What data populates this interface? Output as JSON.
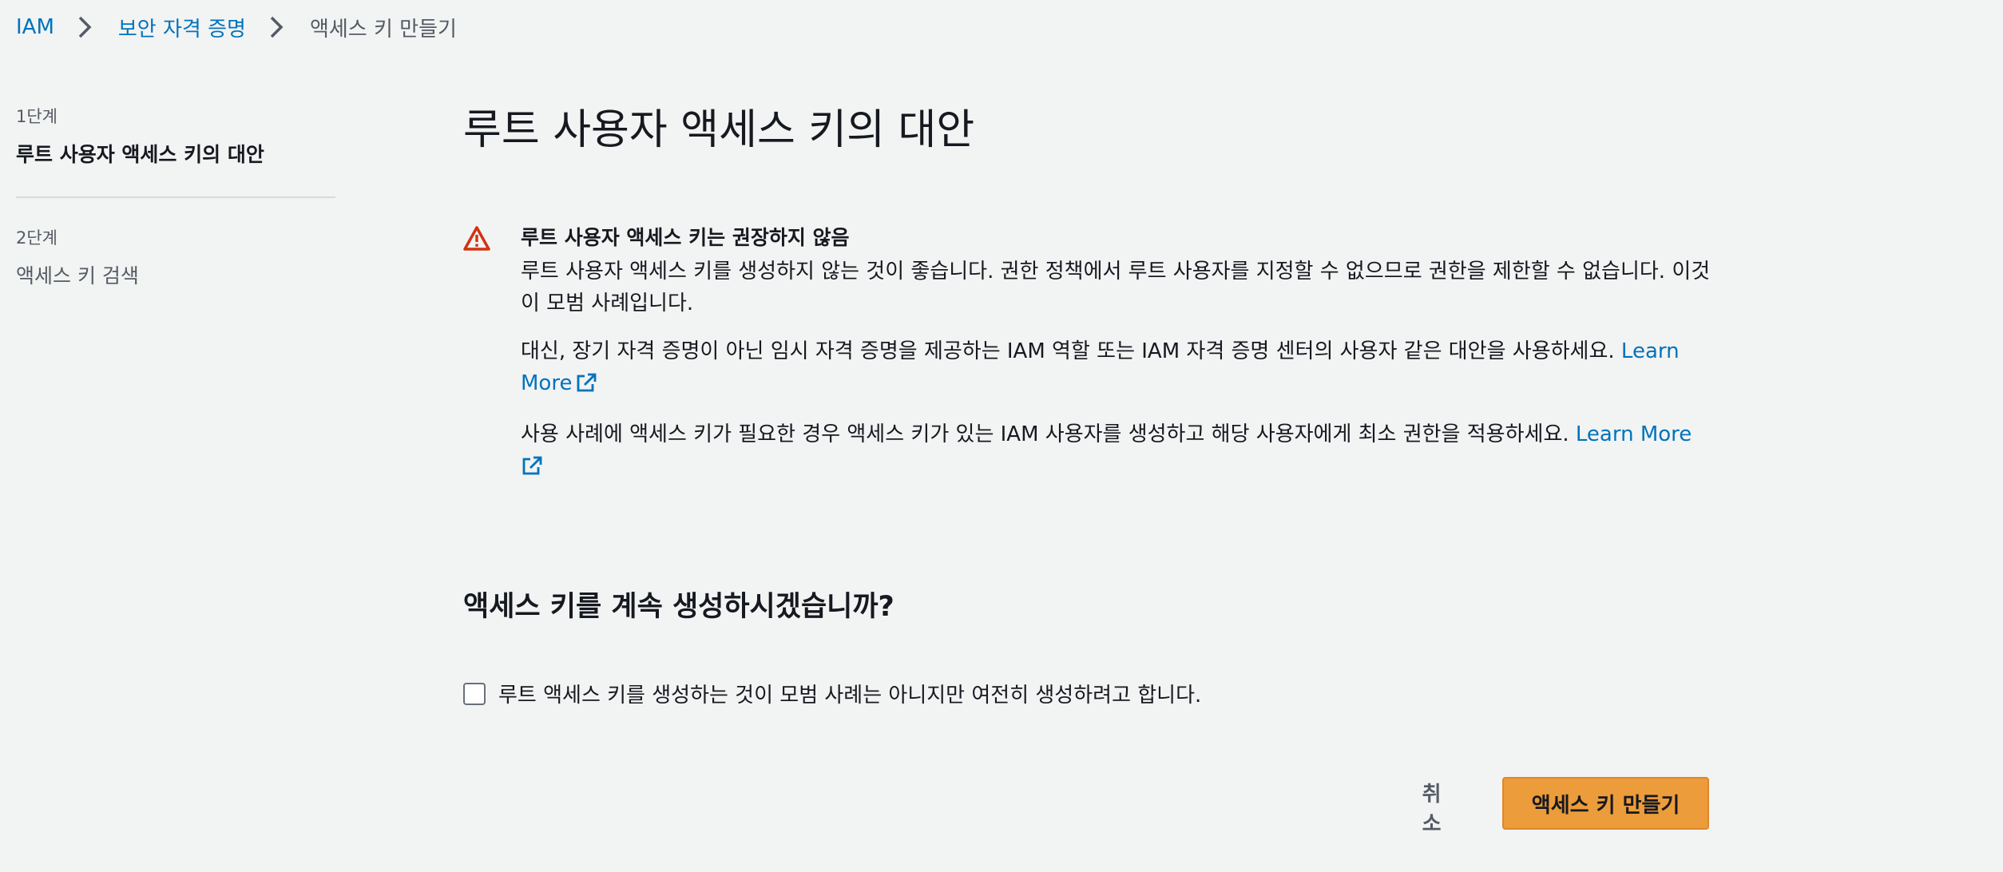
{
  "breadcrumb": {
    "items": [
      {
        "label": "IAM"
      },
      {
        "label": "보안 자격 증명"
      },
      {
        "label": "액세스 키 만들기"
      }
    ]
  },
  "steps": [
    {
      "number": "1단계",
      "title": "루트 사용자 액세스 키의 대안",
      "active": true
    },
    {
      "number": "2단계",
      "title": "액세스 키 검색",
      "active": false
    }
  ],
  "page": {
    "title": "루트 사용자 액세스 키의 대안"
  },
  "alert": {
    "type": "warning",
    "icon": "warning-icon",
    "heading": "루트 사용자 액세스 키는 권장하지 않음",
    "paragraph1": "루트 사용자 액세스 키를 생성하지 않는 것이 좋습니다. 권한 정책에서 루트 사용자를 지정할 수 없으므로 권한을 제한할 수 없습니다. 이것이 모범 사례입니다.",
    "paragraph2": "대신, 장기 자격 증명이 아닌 임시 자격 증명을 제공하는 IAM 역할 또는 IAM 자격 증명 센터의 사용자 같은 대안을 사용하세요.",
    "paragraph2_link": "Learn More",
    "paragraph3": "사용 사례에 액세스 키가 필요한 경우 액세스 키가 있는 IAM 사용자를 생성하고 해당 사용자에게 최소 권한을 적용하세요.",
    "paragraph3_link": "Learn More"
  },
  "question": "액세스 키를 계속 생성하시겠습니까?",
  "confirm": {
    "label": "루트 액세스 키를 생성하는 것이 모범 사례는 아니지만 여전히 생성하려고 합니다.",
    "checked": false
  },
  "actions": {
    "cancel_label": "취소",
    "create_label": "액세스 키 만들기"
  },
  "colors": {
    "link": "#0073bb",
    "primary_button": "#ec9c3a",
    "warning": "#d13212",
    "background": "#f2f3f3"
  }
}
